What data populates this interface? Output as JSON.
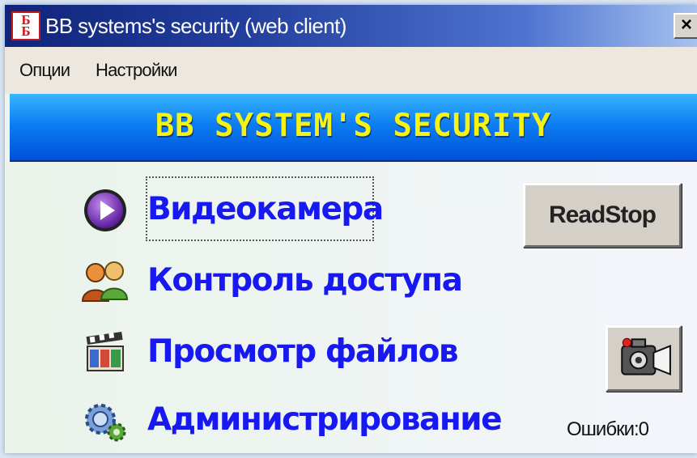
{
  "window": {
    "title": "BB systems's security (web client)",
    "app_icon_text": "Б\nБ",
    "close_glyph": "×"
  },
  "menubar": {
    "items": [
      {
        "label": "Опции"
      },
      {
        "label": "Настройки"
      }
    ]
  },
  "banner": {
    "title": "BB SYSTEM'S SECURITY"
  },
  "nav": {
    "items": [
      {
        "label": "Видеокамера",
        "icon": "play-icon"
      },
      {
        "label": "Контроль доступа",
        "icon": "users-icon"
      },
      {
        "label": "Просмотр файлов",
        "icon": "film-clapper-icon"
      },
      {
        "label": "Администрирование",
        "icon": "gears-icon"
      }
    ]
  },
  "buttons": {
    "readstop_label": "ReadStop",
    "camera_icon": "camera-icon"
  },
  "status": {
    "errors_label": "Ошибки:0"
  },
  "colors": {
    "nav_text": "#1818f0",
    "banner_text": "#f5f311",
    "banner_bg": "#0d7ef2"
  }
}
